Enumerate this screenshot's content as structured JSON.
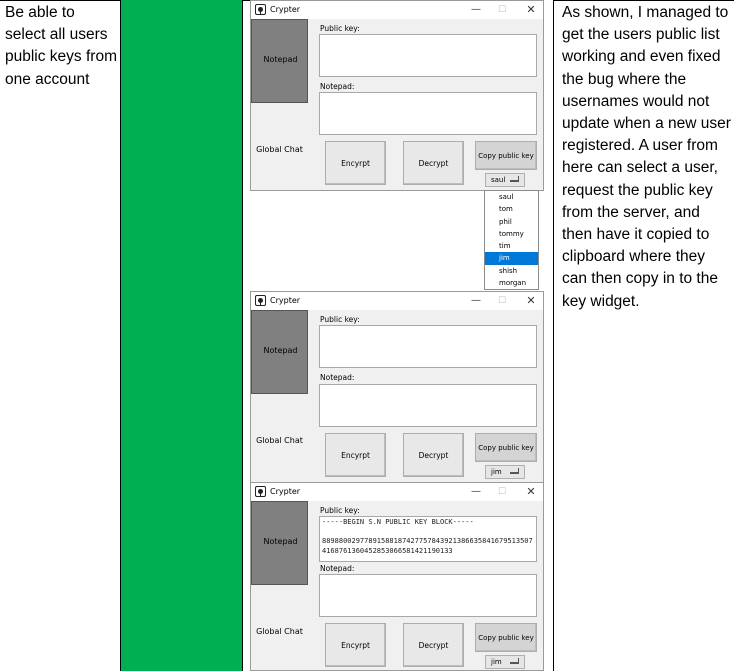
{
  "requirement_text": "Be able to select all users public keys from one account",
  "notes_text": "As shown, I managed to get the users public list working and even fixed the bug where the usernames would not update when a new user registered. A user from here can select a user, request the public key from the server, and then have it copied to clipboard where they can then copy in to the key widget.",
  "status_color": "#00b050",
  "app": {
    "window_title": "Crypter",
    "icon": "padlock-icon",
    "sidebar": {
      "notepad": "Notepad",
      "global_chat": "Global Chat"
    },
    "labels": {
      "public_key": "Public key:",
      "notepad": "Notepad:"
    },
    "buttons": {
      "encrypt": "Encyrpt",
      "decrypt": "Decrypt",
      "copy_public_key": "Copy public key"
    },
    "window_controls": {
      "minimize": "—",
      "maximize": "☐",
      "close": "✕"
    }
  },
  "windows": [
    {
      "selected_user": "saul",
      "public_key_text": ""
    },
    {
      "selected_user": "jim",
      "public_key_text": ""
    },
    {
      "selected_user": "jim",
      "public_key_text": "-----BEGIN S.N PUBLIC KEY BLOCK-----\n\n889880029778915881874277578439213866358416795135074168761360452853066581421190133"
    }
  ],
  "user_dropdown": {
    "options": [
      "saul",
      "tom",
      "phil",
      "tommy",
      "tim",
      "jim",
      "shish",
      "morgan"
    ],
    "highlighted": "jim"
  }
}
